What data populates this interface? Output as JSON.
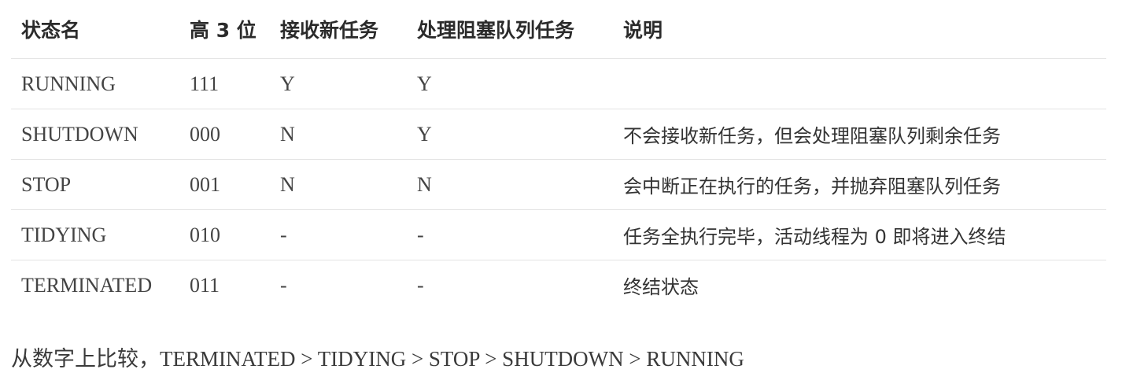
{
  "table": {
    "headers": [
      "状态名",
      "高 3 位",
      "接收新任务",
      "处理阻塞队列任务",
      "说明"
    ],
    "rows": [
      {
        "state": "RUNNING",
        "high_bits": "111",
        "accept_new": "Y",
        "process_queue": "Y",
        "description": ""
      },
      {
        "state": "SHUTDOWN",
        "high_bits": "000",
        "accept_new": "N",
        "process_queue": "Y",
        "description": "不会接收新任务，但会处理阻塞队列剩余任务"
      },
      {
        "state": "STOP",
        "high_bits": "001",
        "accept_new": "N",
        "process_queue": "N",
        "description": "会中断正在执行的任务，并抛弃阻塞队列任务"
      },
      {
        "state": "TIDYING",
        "high_bits": "010",
        "accept_new": "-",
        "process_queue": "-",
        "description": "任务全执行完毕，活动线程为 0 即将进入终结"
      },
      {
        "state": "TERMINATED",
        "high_bits": "011",
        "accept_new": "-",
        "process_queue": "-",
        "description": "终结状态"
      }
    ]
  },
  "footer_note": "从数字上比较，TERMINATED > TIDYING > STOP > SHUTDOWN > RUNNING"
}
